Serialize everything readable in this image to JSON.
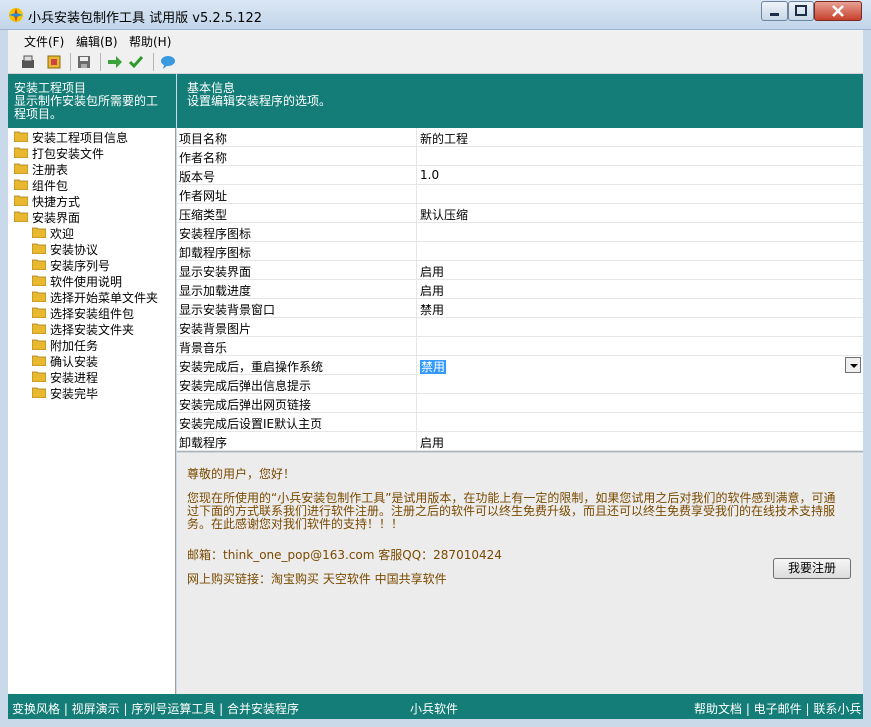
{
  "window": {
    "title": "小兵安装包制作工具 试用版 v5.2.5.122"
  },
  "menu": [
    "文件(F)",
    "编辑(B)",
    "帮助(H)"
  ],
  "left_panel": {
    "header_title": "安装工程项目",
    "header_desc_1": "显示制作安装包所需要的工",
    "header_desc_2": "程项目。",
    "tree": [
      {
        "label": "安装工程项目信息",
        "level": 0
      },
      {
        "label": "打包安装文件",
        "level": 0
      },
      {
        "label": "注册表",
        "level": 0
      },
      {
        "label": "组件包",
        "level": 0
      },
      {
        "label": "快捷方式",
        "level": 0
      },
      {
        "label": "安装界面",
        "level": 0
      },
      {
        "label": "欢迎",
        "level": 1
      },
      {
        "label": "安装协议",
        "level": 1
      },
      {
        "label": "安装序列号",
        "level": 1
      },
      {
        "label": "软件使用说明",
        "level": 1
      },
      {
        "label": "选择开始菜单文件夹",
        "level": 1
      },
      {
        "label": "选择安装组件包",
        "level": 1
      },
      {
        "label": "选择安装文件夹",
        "level": 1
      },
      {
        "label": "附加任务",
        "level": 1
      },
      {
        "label": "确认安装",
        "level": 1
      },
      {
        "label": "安装进程",
        "level": 1
      },
      {
        "label": "安装完毕",
        "level": 1
      }
    ]
  },
  "right_panel": {
    "header_title": "基本信息",
    "header_desc": "设置编辑安装程序的选项。",
    "properties": [
      {
        "key": "项目名称",
        "value": "新的工程"
      },
      {
        "key": "作者名称",
        "value": ""
      },
      {
        "key": "版本号",
        "value": "1.0"
      },
      {
        "key": "作者网址",
        "value": ""
      },
      {
        "key": "压缩类型",
        "value": "默认压缩"
      },
      {
        "key": "安装程序图标",
        "value": ""
      },
      {
        "key": "卸载程序图标",
        "value": ""
      },
      {
        "key": "显示安装界面",
        "value": "启用"
      },
      {
        "key": "显示加载进度",
        "value": "启用"
      },
      {
        "key": "显示安装背景窗口",
        "value": "禁用"
      },
      {
        "key": "安装背景图片",
        "value": ""
      },
      {
        "key": "背景音乐",
        "value": ""
      },
      {
        "key": "安装完成后，重启操作系统",
        "value": "禁用"
      },
      {
        "key": "安装完成后弹出信息提示",
        "value": ""
      },
      {
        "key": "安装完成后弹出网页链接",
        "value": ""
      },
      {
        "key": "安装完成后设置IE默认主页",
        "value": ""
      },
      {
        "key": "卸载程序",
        "value": "启用"
      }
    ]
  },
  "notice": {
    "greeting": "尊敬的用户，您好！",
    "line1": "您现在所使用的“小兵安装包制作工具”是试用版本，在功能上有一定的限制，如果您试用之后对我们的软件感到满意，可通",
    "line2": "过下面的方式联系我们进行软件注册。注册之后的软件可以终生免费升级，而且还可以终生免费享受我们的在线技术支持服",
    "line3": "务。在此感谢您对我们软件的支持！！！",
    "contact": "邮箱：think_one_pop@163.com  客服QQ：287010424",
    "buy_links": "网上购买链接：淘宝购买  天空软件  中国共享软件",
    "register_button": "我要注册"
  },
  "statusbar": {
    "left_links": "变换风格 | 视屏演示 | 序列号运算工具 | 合并安装程序",
    "center": "小兵软件",
    "right_links": "帮助文档 | 电子邮件 | 联系小兵"
  }
}
